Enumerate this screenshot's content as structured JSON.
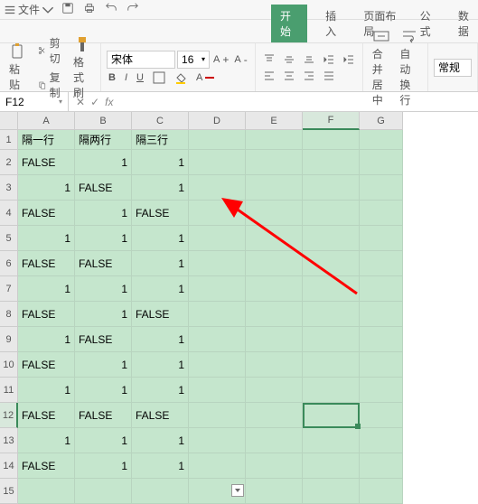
{
  "titlebar": {
    "menu_label": "文件"
  },
  "tabs": {
    "start": "开始",
    "insert": "插入",
    "layout": "页面布局",
    "formula": "公式",
    "data": "数据"
  },
  "ribbon": {
    "paste_label": "粘贴",
    "cut_label": "剪切",
    "copy_label": "复制",
    "format_painter_label": "格式刷",
    "font_name": "宋体",
    "font_size": "16",
    "merge_label": "合并居中",
    "wrap_label": "自动换行",
    "style_label": "常规"
  },
  "namebox": {
    "ref": "F12"
  },
  "columns": [
    "A",
    "B",
    "C",
    "D",
    "E",
    "F",
    "G"
  ],
  "rows": [
    "1",
    "2",
    "3",
    "4",
    "5",
    "6",
    "7",
    "8",
    "9",
    "10",
    "11",
    "12",
    "13",
    "14",
    "15"
  ],
  "active": {
    "col": 5,
    "row": 11
  },
  "grid": [
    [
      "隔一行",
      "隔两行",
      "隔三行",
      "",
      "",
      "",
      ""
    ],
    [
      "FALSE",
      "1",
      "1",
      "",
      "",
      "",
      ""
    ],
    [
      "1",
      "FALSE",
      "1",
      "",
      "",
      "",
      ""
    ],
    [
      "FALSE",
      "1",
      "FALSE",
      "",
      "",
      "",
      ""
    ],
    [
      "1",
      "1",
      "1",
      "",
      "",
      "",
      ""
    ],
    [
      "FALSE",
      "FALSE",
      "1",
      "",
      "",
      "",
      ""
    ],
    [
      "1",
      "1",
      "1",
      "",
      "",
      "",
      ""
    ],
    [
      "FALSE",
      "1",
      "FALSE",
      "",
      "",
      "",
      ""
    ],
    [
      "1",
      "FALSE",
      "1",
      "",
      "",
      "",
      ""
    ],
    [
      "FALSE",
      "1",
      "1",
      "",
      "",
      "",
      ""
    ],
    [
      "1",
      "1",
      "1",
      "",
      "",
      "",
      ""
    ],
    [
      "FALSE",
      "FALSE",
      "FALSE",
      "",
      "",
      "",
      ""
    ],
    [
      "1",
      "1",
      "1",
      "",
      "",
      "",
      ""
    ],
    [
      "FALSE",
      "1",
      "1",
      "",
      "",
      "",
      ""
    ],
    [
      "",
      "",
      "",
      "",
      "",
      "",
      ""
    ]
  ],
  "align": [
    [
      "l",
      "l",
      "l",
      "l",
      "l",
      "l",
      "l"
    ],
    [
      "l",
      "r",
      "r",
      "l",
      "l",
      "l",
      "l"
    ],
    [
      "r",
      "l",
      "r",
      "l",
      "l",
      "l",
      "l"
    ],
    [
      "l",
      "r",
      "l",
      "l",
      "l",
      "l",
      "l"
    ],
    [
      "r",
      "r",
      "r",
      "l",
      "l",
      "l",
      "l"
    ],
    [
      "l",
      "l",
      "r",
      "l",
      "l",
      "l",
      "l"
    ],
    [
      "r",
      "r",
      "r",
      "l",
      "l",
      "l",
      "l"
    ],
    [
      "l",
      "r",
      "l",
      "l",
      "l",
      "l",
      "l"
    ],
    [
      "r",
      "l",
      "r",
      "l",
      "l",
      "l",
      "l"
    ],
    [
      "l",
      "r",
      "r",
      "l",
      "l",
      "l",
      "l"
    ],
    [
      "r",
      "r",
      "r",
      "l",
      "l",
      "l",
      "l"
    ],
    [
      "l",
      "l",
      "l",
      "l",
      "l",
      "l",
      "l"
    ],
    [
      "r",
      "r",
      "r",
      "l",
      "l",
      "l",
      "l"
    ],
    [
      "l",
      "r",
      "r",
      "l",
      "l",
      "l",
      "l"
    ],
    [
      "l",
      "l",
      "l",
      "l",
      "l",
      "l",
      "l"
    ]
  ]
}
